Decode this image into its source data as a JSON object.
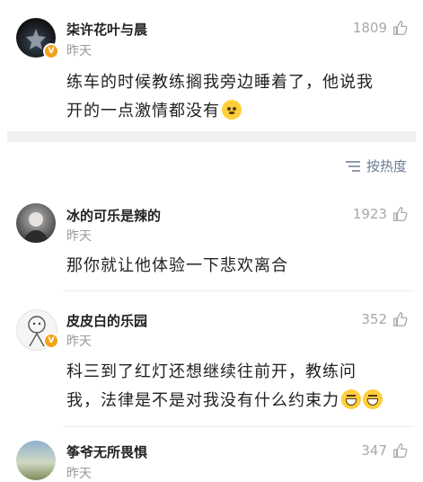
{
  "comments": [
    {
      "name": "柒许花叶与晨",
      "time": "昨天",
      "likes": "1809",
      "text_lines": [
        "练车的时候教练搁我旁边睡着了，他说我",
        "开的一点激情都没有"
      ]
    },
    {
      "name": "冰的可乐是辣的",
      "time": "昨天",
      "likes": "1923",
      "text_lines": [
        "那你就让他体验一下悲欢离合"
      ]
    },
    {
      "name": "皮皮白的乐园",
      "time": "昨天",
      "likes": "352",
      "text_lines": [
        "科三到了红灯还想继续往前开，教练问",
        "我，法律是不是对我没有什么约束力"
      ]
    },
    {
      "name": "筝爷无所畏惧",
      "time": "昨天",
      "likes": "347",
      "text_lines": []
    }
  ],
  "sort": {
    "label": "按热度"
  },
  "colors": {
    "accent": "#6b7a91",
    "badge": "#f4a11c",
    "muted": "#9a9a9a"
  },
  "icons": {
    "like": "thumbs-up-icon",
    "sort": "sort-lines-icon",
    "verified": "verified-badge-icon"
  }
}
